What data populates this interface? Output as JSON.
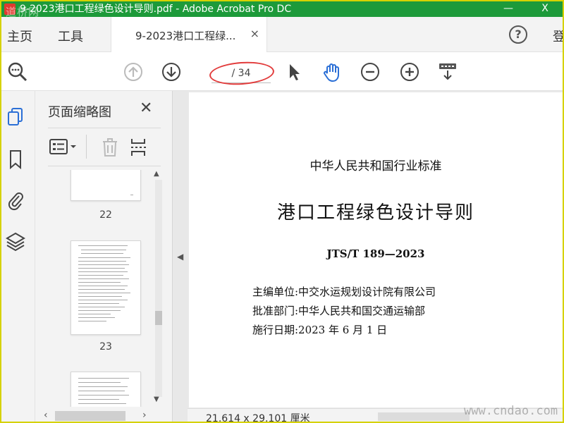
{
  "window": {
    "title": "9-2023港口工程绿色设计导则.pdf - Adobe Acrobat Pro DC",
    "watermark_top": "道桥网",
    "minimize_label": "—",
    "close_label": "X"
  },
  "tabbar": {
    "home": "主页",
    "tools": "工具",
    "doc_tab": "9-2023港口工程绿...",
    "doc_tab_close": "×",
    "help": "?",
    "signin": "登"
  },
  "toolbar": {
    "page_indicator": "/ 34",
    "icons": [
      "zoom-search-icon",
      "prev-page-icon",
      "next-page-icon",
      "select-arrow-icon",
      "hand-icon",
      "zoom-out-icon",
      "zoom-in-icon",
      "scroll-mode-icon"
    ]
  },
  "sidebar": {
    "panel_title": "页面缩略图",
    "panel_close": "✕",
    "rail_icons": [
      "pages-icon",
      "bookmark-icon",
      "attachment-icon",
      "layers-icon"
    ],
    "thumbnails": [
      {
        "page": "22"
      },
      {
        "page": "23"
      }
    ]
  },
  "document": {
    "header": "中华人民共和国行业标准",
    "title": "港口工程绿色设计导则",
    "code": "JTS/T 189—2023",
    "info": [
      "主编单位:中交水运规划设计院有限公司",
      "批准部门:中华人民共和国交通运输部",
      "施行日期:2023 年 6 月 1 日"
    ]
  },
  "status": {
    "dimensions": "21.614 x 29.101 厘米",
    "watermark_bottom": "www.cndao.com"
  },
  "colors": {
    "titlebar": "#1d9a3a",
    "frame": "#d6d200",
    "annotation_oval": "#e23c3c",
    "accent_blue": "#2b6fd6"
  }
}
